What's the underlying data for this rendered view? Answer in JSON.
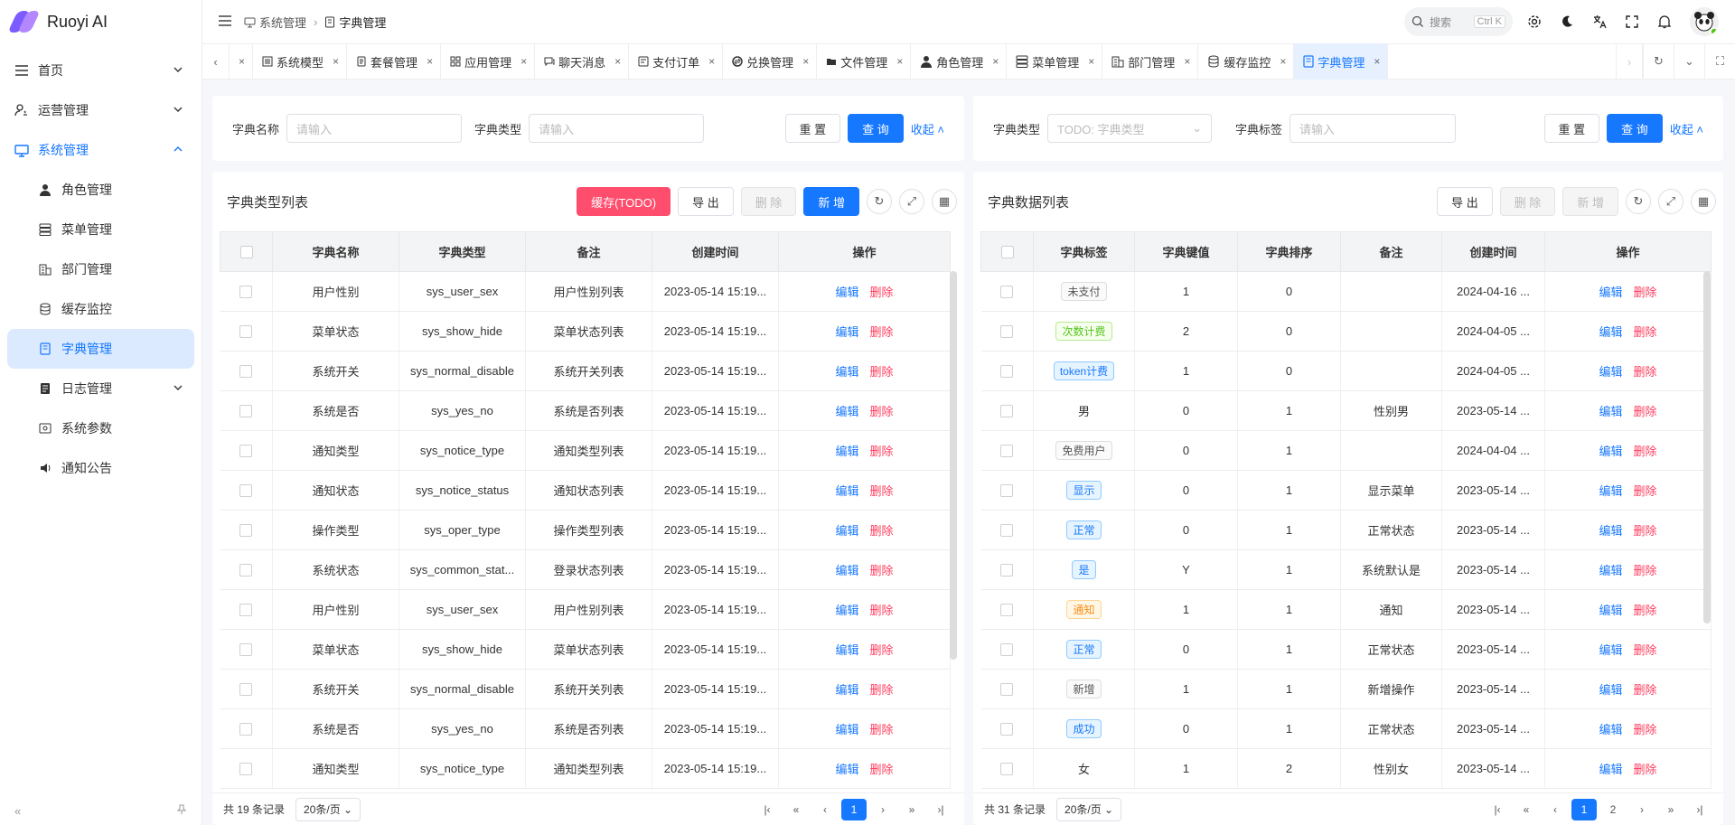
{
  "app": {
    "name": "Ruoyi AI"
  },
  "colors": {
    "primary": "#1677ff",
    "danger": "#ff4d6d",
    "delete_link": "#ff3b5c"
  },
  "sidebar": {
    "items": [
      {
        "label": "首页",
        "icon": "menu-lines-icon",
        "expandable": true
      },
      {
        "label": "运营管理",
        "icon": "user-settings-icon",
        "expandable": true
      },
      {
        "label": "系统管理",
        "icon": "monitor-icon",
        "expandable": true,
        "expanded": true
      }
    ],
    "sub_items": [
      {
        "label": "角色管理",
        "icon": "person-icon"
      },
      {
        "label": "菜单管理",
        "icon": "stack-icon"
      },
      {
        "label": "部门管理",
        "icon": "building-icon"
      },
      {
        "label": "缓存监控",
        "icon": "database-icon"
      },
      {
        "label": "字典管理",
        "icon": "book-icon",
        "selected": true
      },
      {
        "label": "日志管理",
        "icon": "log-icon",
        "expandable": true
      },
      {
        "label": "系统参数",
        "icon": "config-icon"
      },
      {
        "label": "通知公告",
        "icon": "speaker-icon"
      }
    ]
  },
  "header": {
    "breadcrumb": [
      "系统管理",
      "字典管理"
    ],
    "search_label": "搜索",
    "search_shortcut": "Ctrl K"
  },
  "tabs": [
    {
      "label": "",
      "icon": ""
    },
    {
      "label": "系统模型",
      "icon": "list-icon"
    },
    {
      "label": "套餐管理",
      "icon": "doc-icon"
    },
    {
      "label": "应用管理",
      "icon": "grid-icon"
    },
    {
      "label": "聊天消息",
      "icon": "chat-icon"
    },
    {
      "label": "支付订单",
      "icon": "order-icon"
    },
    {
      "label": "兑换管理",
      "icon": "exchange-icon"
    },
    {
      "label": "文件管理",
      "icon": "folder-icon"
    },
    {
      "label": "角色管理",
      "icon": "person-icon"
    },
    {
      "label": "菜单管理",
      "icon": "stack-icon"
    },
    {
      "label": "部门管理",
      "icon": "building-icon"
    },
    {
      "label": "缓存监控",
      "icon": "database-icon"
    },
    {
      "label": "字典管理",
      "icon": "book-icon",
      "active": true
    }
  ],
  "left_filter": {
    "name_label": "字典名称",
    "name_placeholder": "请输入",
    "type_label": "字典类型",
    "type_placeholder": "请输入",
    "reset": "重 置",
    "query": "查 询",
    "collapse": "收起"
  },
  "right_filter": {
    "type_label": "字典类型",
    "type_placeholder": "TODO: 字典类型",
    "tag_label": "字典标签",
    "tag_placeholder": "请输入",
    "reset": "重 置",
    "query": "查 询",
    "collapse": "收起"
  },
  "left_list": {
    "title": "字典类型列表",
    "btn_cache": "缓存(TODO)",
    "btn_export": "导 出",
    "btn_delete": "删 除",
    "btn_add": "新 增",
    "columns": [
      "字典名称",
      "字典类型",
      "备注",
      "创建时间",
      "操作"
    ],
    "rows": [
      [
        "用户性别",
        "sys_user_sex",
        "用户性别列表",
        "2023-05-14 15:19..."
      ],
      [
        "菜单状态",
        "sys_show_hide",
        "菜单状态列表",
        "2023-05-14 15:19..."
      ],
      [
        "系统开关",
        "sys_normal_disable",
        "系统开关列表",
        "2023-05-14 15:19..."
      ],
      [
        "系统是否",
        "sys_yes_no",
        "系统是否列表",
        "2023-05-14 15:19..."
      ],
      [
        "通知类型",
        "sys_notice_type",
        "通知类型列表",
        "2023-05-14 15:19..."
      ],
      [
        "通知状态",
        "sys_notice_status",
        "通知状态列表",
        "2023-05-14 15:19..."
      ],
      [
        "操作类型",
        "sys_oper_type",
        "操作类型列表",
        "2023-05-14 15:19..."
      ],
      [
        "系统状态",
        "sys_common_stat...",
        "登录状态列表",
        "2023-05-14 15:19..."
      ],
      [
        "用户性别",
        "sys_user_sex",
        "用户性别列表",
        "2023-05-14 15:19..."
      ],
      [
        "菜单状态",
        "sys_show_hide",
        "菜单状态列表",
        "2023-05-14 15:19..."
      ],
      [
        "系统开关",
        "sys_normal_disable",
        "系统开关列表",
        "2023-05-14 15:19..."
      ],
      [
        "系统是否",
        "sys_yes_no",
        "系统是否列表",
        "2023-05-14 15:19..."
      ],
      [
        "通知类型",
        "sys_notice_type",
        "通知类型列表",
        "2023-05-14 15:19..."
      ]
    ],
    "edit": "编辑",
    "delete": "删除",
    "total": "共 19 条记录",
    "page_size": "20条/页",
    "pages": [
      "1"
    ],
    "current_page": "1"
  },
  "right_list": {
    "title": "字典数据列表",
    "btn_export": "导 出",
    "btn_delete": "删 除",
    "btn_add": "新 增",
    "columns": [
      "字典标签",
      "字典键值",
      "字典排序",
      "备注",
      "创建时间",
      "操作"
    ],
    "rows": [
      {
        "tag": "未支付",
        "style": "default",
        "key": "1",
        "sort": "0",
        "remark": "",
        "time": "2024-04-16 ..."
      },
      {
        "tag": "次数计费",
        "style": "green",
        "key": "2",
        "sort": "0",
        "remark": "",
        "time": "2024-04-05 ..."
      },
      {
        "tag": "token计费",
        "style": "blue",
        "key": "1",
        "sort": "0",
        "remark": "",
        "time": "2024-04-05 ..."
      },
      {
        "tag": "男",
        "style": "plain",
        "key": "0",
        "sort": "1",
        "remark": "性别男",
        "time": "2023-05-14 ..."
      },
      {
        "tag": "免费用户",
        "style": "default",
        "key": "0",
        "sort": "1",
        "remark": "",
        "time": "2024-04-04 ..."
      },
      {
        "tag": "显示",
        "style": "blue",
        "key": "0",
        "sort": "1",
        "remark": "显示菜单",
        "time": "2023-05-14 ..."
      },
      {
        "tag": "正常",
        "style": "blue",
        "key": "0",
        "sort": "1",
        "remark": "正常状态",
        "time": "2023-05-14 ..."
      },
      {
        "tag": "是",
        "style": "blue",
        "key": "Y",
        "sort": "1",
        "remark": "系统默认是",
        "time": "2023-05-14 ..."
      },
      {
        "tag": "通知",
        "style": "orange",
        "key": "1",
        "sort": "1",
        "remark": "通知",
        "time": "2023-05-14 ..."
      },
      {
        "tag": "正常",
        "style": "blue",
        "key": "0",
        "sort": "1",
        "remark": "正常状态",
        "time": "2023-05-14 ..."
      },
      {
        "tag": "新增",
        "style": "default",
        "key": "1",
        "sort": "1",
        "remark": "新增操作",
        "time": "2023-05-14 ..."
      },
      {
        "tag": "成功",
        "style": "blue",
        "key": "0",
        "sort": "1",
        "remark": "正常状态",
        "time": "2023-05-14 ..."
      },
      {
        "tag": "女",
        "style": "plain",
        "key": "1",
        "sort": "2",
        "remark": "性别女",
        "time": "2023-05-14 ..."
      }
    ],
    "edit": "编辑",
    "delete": "删除",
    "total": "共 31 条记录",
    "page_size": "20条/页",
    "pages": [
      "1",
      "2"
    ],
    "current_page": "1"
  }
}
